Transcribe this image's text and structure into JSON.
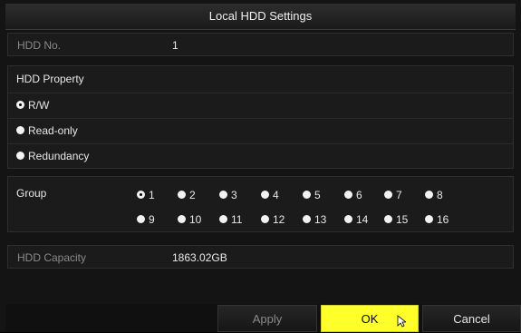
{
  "window": {
    "title": "Local HDD Settings"
  },
  "hdd_no": {
    "label": "HDD No.",
    "value": "1"
  },
  "property": {
    "label": "HDD Property",
    "options": [
      {
        "label": "R/W",
        "checked": true
      },
      {
        "label": "Read-only",
        "checked": false
      },
      {
        "label": "Redundancy",
        "checked": false
      }
    ]
  },
  "group": {
    "label": "Group",
    "options": [
      "1",
      "2",
      "3",
      "4",
      "5",
      "6",
      "7",
      "8",
      "9",
      "10",
      "11",
      "12",
      "13",
      "14",
      "15",
      "16"
    ],
    "selected": "1"
  },
  "capacity": {
    "label": "HDD Capacity",
    "value": "1863.02GB"
  },
  "buttons": {
    "apply": "Apply",
    "ok": "OK",
    "cancel": "Cancel"
  },
  "colors": {
    "ok_highlight": "#ffff2a",
    "background": "#141414"
  }
}
